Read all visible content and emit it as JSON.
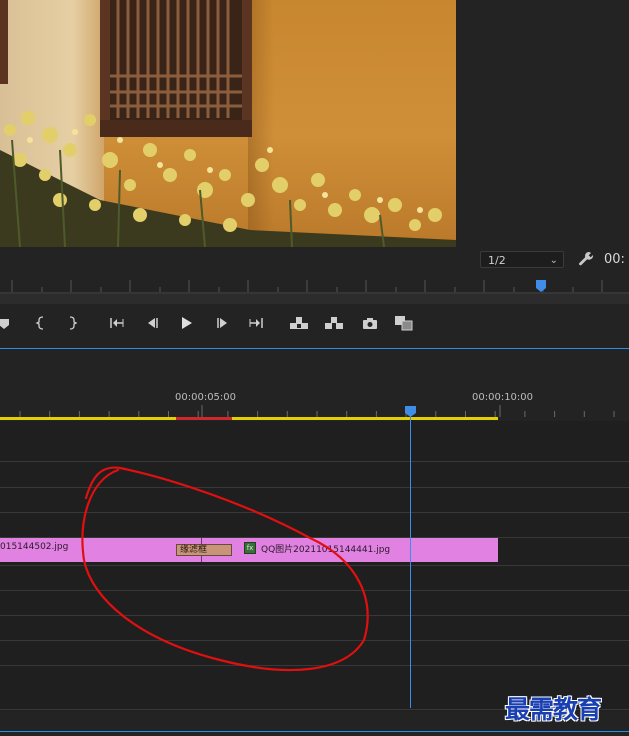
{
  "monitor": {
    "resolution_value": "1/2",
    "resolution_options_visible": [
      "1/2"
    ],
    "timecode": "00:"
  },
  "transport": {
    "buttons": [
      {
        "name": "add-marker-button",
        "icon": "marker-icon"
      },
      {
        "name": "mark-in-button",
        "icon": "mark-in-icon"
      },
      {
        "name": "mark-out-button",
        "icon": "mark-out-icon"
      },
      {
        "name": "go-to-in-button",
        "icon": "go-to-in-icon"
      },
      {
        "name": "step-back-button",
        "icon": "step-back-icon"
      },
      {
        "name": "play-button",
        "icon": "play-icon"
      },
      {
        "name": "step-forward-button",
        "icon": "step-forward-icon"
      },
      {
        "name": "go-to-out-button",
        "icon": "go-to-out-icon"
      },
      {
        "name": "lift-button",
        "icon": "lift-icon"
      },
      {
        "name": "extract-button",
        "icon": "extract-icon"
      },
      {
        "name": "export-frame-button",
        "icon": "camera-icon"
      },
      {
        "name": "comparison-view-button",
        "icon": "comparison-icon"
      }
    ]
  },
  "timeline": {
    "ruler_labels": [
      "00:00:05:00",
      "00:00:10:00"
    ],
    "clip_left_name": "015144502.jpg",
    "clip_right_name": "QQ图片20211015144441.jpg",
    "transition_label": "缘滤框",
    "fx_badge": "fx",
    "work_area_color": "#e2d000",
    "render_bar_color": "#cc2a2a",
    "clip_color": "#e181e1",
    "playhead_color": "#3f8de6"
  },
  "annotation": {
    "color": "#e01010"
  },
  "watermark": {
    "text": "最需教育"
  }
}
